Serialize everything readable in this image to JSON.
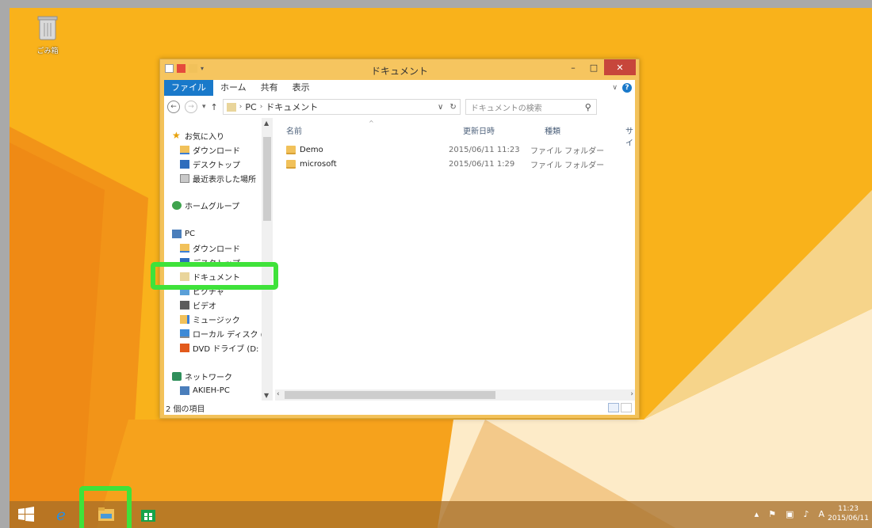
{
  "desktop": {
    "recycle_bin_label": "ごみ箱"
  },
  "window": {
    "title": "ドキュメント",
    "minimize": "–",
    "maximize": "□",
    "close": "✕",
    "ribbon_tabs": [
      "ファイル",
      "ホーム",
      "共有",
      "表示"
    ],
    "address": {
      "back": "←",
      "forward": "→",
      "up": "↑",
      "path": [
        "PC",
        "ドキュメント"
      ],
      "refresh": "↻",
      "search_placeholder": "ドキュメントの検索"
    },
    "nav": {
      "favorites": "お気に入り",
      "downloads": "ダウンロード",
      "desktop": "デスクトップ",
      "recent": "最近表示した場所",
      "homegroup": "ホームグループ",
      "pc": "PC",
      "pc_downloads": "ダウンロード",
      "pc_desktop": "デスクトップ",
      "documents": "ドキュメント",
      "pictures": "ピクチャ",
      "videos": "ビデオ",
      "music": "ミュージック",
      "local_disk": "ローカル ディスク (C",
      "dvd": "DVD ドライブ (D:",
      "network": "ネットワーク",
      "network_pc": "AKIEH-PC"
    },
    "columns": {
      "name": "名前",
      "date": "更新日時",
      "type": "種類",
      "size": "サイ"
    },
    "files": [
      {
        "name": "Demo",
        "date": "2015/06/11 11:23",
        "type": "ファイル フォルダー"
      },
      {
        "name": "microsoft",
        "date": "2015/06/11 1:29",
        "type": "ファイル フォルダー"
      }
    ],
    "status": "2 個の項目"
  },
  "taskbar": {
    "clock_time": "11:23",
    "clock_date": "2015/06/11",
    "ime": "A"
  },
  "colors": {
    "wallpaper": "#f9b21b",
    "highlight": "#3fe23a",
    "ribbon_file_tab": "#1979ca",
    "close_button": "#c7463b"
  }
}
